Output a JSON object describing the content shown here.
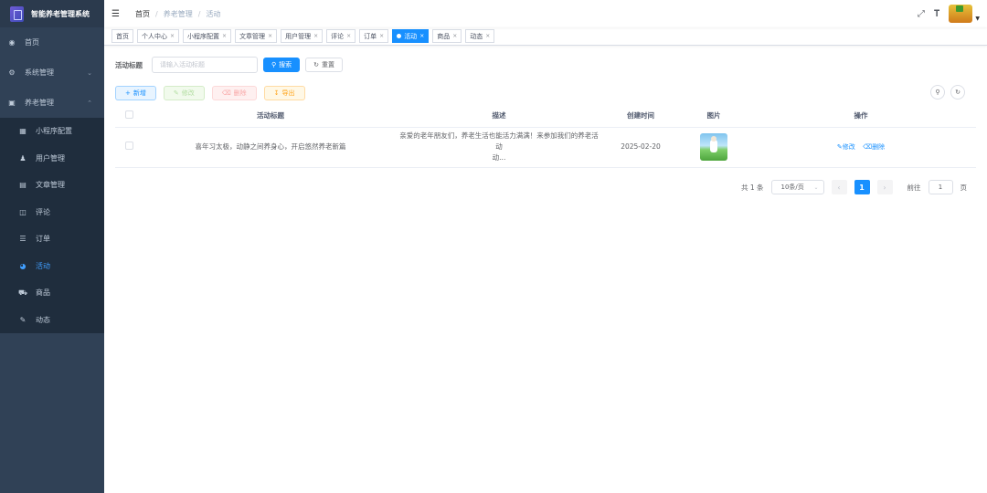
{
  "app": {
    "title": "智能养老管理系统"
  },
  "sidebar": {
    "items": [
      {
        "label": "首页",
        "icon": "dashboard-icon"
      },
      {
        "label": "系统管理",
        "icon": "gear-icon"
      },
      {
        "label": "养老管理",
        "icon": "monitor-icon"
      }
    ],
    "submenu": [
      {
        "label": "小程序配置",
        "icon": "grid-icon"
      },
      {
        "label": "用户管理",
        "icon": "user-icon"
      },
      {
        "label": "文章管理",
        "icon": "document-icon"
      },
      {
        "label": "评论",
        "icon": "book-icon"
      },
      {
        "label": "订单",
        "icon": "list-icon"
      },
      {
        "label": "活动",
        "icon": "globe-icon"
      },
      {
        "label": "商品",
        "icon": "cart-icon"
      },
      {
        "label": "动态",
        "icon": "edit-icon"
      }
    ]
  },
  "breadcrumb": [
    "首页",
    "养老管理",
    "活动"
  ],
  "tags": [
    "首页",
    "个人中心",
    "小程序配置",
    "文章管理",
    "用户管理",
    "评论",
    "订单",
    "活动",
    "商品",
    "动态"
  ],
  "search": {
    "label": "活动标题",
    "placeholder": "请输入活动标题",
    "search_button": "搜索",
    "reset_button": "重置"
  },
  "actions": {
    "add": "新增",
    "edit": "修改",
    "delete": "删除",
    "export": "导出"
  },
  "table": {
    "headers": [
      "活动标题",
      "描述",
      "创建时间",
      "图片",
      "操作"
    ],
    "rows": [
      {
        "title": "喜年习太极，动静之间养身心，开启悠然养老新篇",
        "desc_line1": "亲爱的老年朋友们，养老生活也能活力满满！来参加我们的养老活动",
        "desc_line2": "动...",
        "created": "2025-02-20",
        "edit": "修改",
        "delete": "删除"
      }
    ]
  },
  "pagination": {
    "total": "共 1 条",
    "page_size": "10条/页",
    "current_page": "1",
    "goto_label": "前往",
    "goto_value": "1",
    "page_unit": "页"
  },
  "colors": {
    "accent": "#1890ff",
    "sidebar_bg": "#304156",
    "submenu_bg": "#1f2d3d"
  }
}
